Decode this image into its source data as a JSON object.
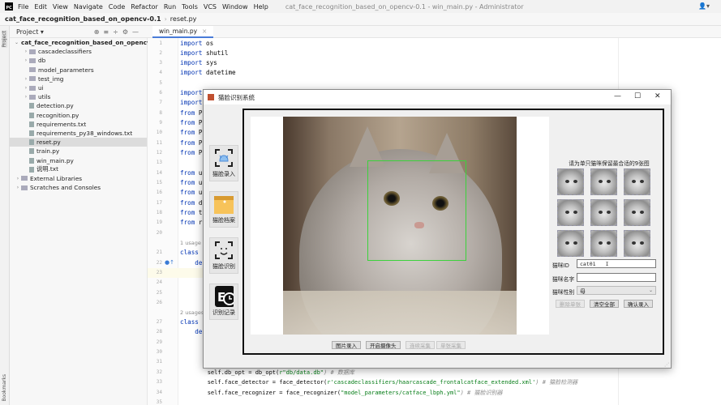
{
  "app": {
    "logo": "PC",
    "menu": [
      "File",
      "Edit",
      "View",
      "Navigate",
      "Code",
      "Refactor",
      "Run",
      "Tools",
      "VCS",
      "Window",
      "Help"
    ],
    "window_title": "cat_face_recognition_based_on_opencv-0.1 - win_main.py - Administrator"
  },
  "breadcrumb": {
    "project": "cat_face_recognition_based_on_opencv-0.1",
    "file": "reset.py"
  },
  "left_strip": {
    "top": "Project",
    "bottom": "Bookmarks"
  },
  "project_panel": {
    "title": "Project ▾",
    "tree": [
      {
        "label": "cat_face_recognition_based_on_opencv-0.1",
        "type": "folder",
        "depth": 0,
        "arrow": "⌄",
        "bold": true
      },
      {
        "label": "cascadeclassifiers",
        "type": "folder",
        "depth": 1,
        "arrow": "›"
      },
      {
        "label": "db",
        "type": "folder",
        "depth": 1,
        "arrow": "›"
      },
      {
        "label": "model_parameters",
        "type": "folder",
        "depth": 1,
        "arrow": ""
      },
      {
        "label": "test_img",
        "type": "folder",
        "depth": 1,
        "arrow": "›"
      },
      {
        "label": "ui",
        "type": "folder",
        "depth": 1,
        "arrow": "›"
      },
      {
        "label": "utils",
        "type": "folder",
        "depth": 1,
        "arrow": "›"
      },
      {
        "label": "detection.py",
        "type": "file",
        "depth": 1
      },
      {
        "label": "recognition.py",
        "type": "file",
        "depth": 1
      },
      {
        "label": "requirements.txt",
        "type": "file",
        "depth": 1
      },
      {
        "label": "requirements_py38_windows.txt",
        "type": "file",
        "depth": 1
      },
      {
        "label": "reset.py",
        "type": "file",
        "depth": 1,
        "selected": true
      },
      {
        "label": "train.py",
        "type": "file",
        "depth": 1
      },
      {
        "label": "win_main.py",
        "type": "file",
        "depth": 1
      },
      {
        "label": "说明.txt",
        "type": "file",
        "depth": 1
      },
      {
        "label": "External Libraries",
        "type": "folder",
        "depth": 0,
        "arrow": "›"
      },
      {
        "label": "Scratches and Consoles",
        "type": "folder",
        "depth": 0,
        "arrow": "›"
      }
    ]
  },
  "editor": {
    "tab": "win_main.py",
    "lines": [
      {
        "n": "1",
        "kw": "import",
        "rest": " os"
      },
      {
        "n": "2",
        "kw": "import",
        "rest": " shutil"
      },
      {
        "n": "3",
        "kw": "import",
        "rest": " sys"
      },
      {
        "n": "4",
        "kw": "import",
        "rest": " datetime"
      },
      {
        "n": "5"
      },
      {
        "n": "6",
        "kw": "import",
        "rest": ""
      },
      {
        "n": "7",
        "kw": "import",
        "rest": ""
      },
      {
        "n": "8",
        "kw": "from",
        "rest": " P"
      },
      {
        "n": "9",
        "kw": "from",
        "rest": " P"
      },
      {
        "n": "10",
        "kw": "from",
        "rest": " P"
      },
      {
        "n": "11",
        "kw": "from",
        "rest": " P"
      },
      {
        "n": "12",
        "kw": "from",
        "rest": " P"
      },
      {
        "n": "13"
      },
      {
        "n": "14",
        "kw": "from",
        "rest": " u"
      },
      {
        "n": "15",
        "kw": "from",
        "rest": " u"
      },
      {
        "n": "16",
        "kw": "from",
        "rest": " u"
      },
      {
        "n": "17",
        "kw": "from",
        "rest": " d"
      },
      {
        "n": "18",
        "kw": "from",
        "rest": " t"
      },
      {
        "n": "19",
        "kw": "from",
        "rest": " r"
      },
      {
        "n": "20"
      },
      {
        "n": "21",
        "kw": "class",
        "rest": " ",
        "usage": "1 usage"
      },
      {
        "n": "22",
        "kw": "    de",
        "rest": ""
      },
      {
        "n": "23"
      },
      {
        "n": "24"
      },
      {
        "n": "25"
      },
      {
        "n": "26"
      },
      {
        "n": "27",
        "kw": "class",
        "rest": " ",
        "usage": "2 usages"
      },
      {
        "n": "28",
        "kw": "    de",
        "rest": ""
      },
      {
        "n": "29"
      },
      {
        "n": "30"
      },
      {
        "n": "31"
      },
      {
        "n": "32",
        "code": "        self.db_opt = db_opt(",
        "str": "r\"db/data.db\"",
        "cmt": ") # 数据库"
      },
      {
        "n": "33",
        "code": "        self.face_detector = face_detector(",
        "str": "r'cascadeclassifiers/haarcascade_frontalcatface_extended.xml'",
        "cmt": ") # 猫脸检测器"
      },
      {
        "n": "34",
        "code": "        self.face_recognizer = face_recognizer(",
        "str": "\"model_parameters/catface_lbph.yml\"",
        "cmt": ") # 猫脸识别器"
      },
      {
        "n": "35"
      }
    ]
  },
  "dialog": {
    "title": "猫脸识别系统",
    "controls": {
      "minimize": "—",
      "maximize": "☐",
      "close": "✕"
    },
    "side_buttons": [
      {
        "label": "猫脸录入",
        "icon": "cat-scan-icon"
      },
      {
        "label": "猫脸档案",
        "icon": "archive-folder-icon"
      },
      {
        "label": "猫脸识别",
        "icon": "face-recognition-icon"
      },
      {
        "label": "识别记录",
        "icon": "history-record-icon"
      }
    ],
    "image_buttons": [
      {
        "label": "图片录入",
        "enabled": true
      },
      {
        "label": "开启摄像头",
        "enabled": true
      },
      {
        "label": "连续采集",
        "enabled": false
      },
      {
        "label": "单张采集",
        "enabled": false
      }
    ],
    "thumb_hint": "请为单只猫咪保留最合适的9张图",
    "thumb_count": 9,
    "form": {
      "id_label": "猫咪ID",
      "id_value": "cat01",
      "name_label": "猫咪名字",
      "name_value": "",
      "gender_label": "猫咪性别",
      "gender_value": "母"
    },
    "action_buttons": [
      {
        "label": "删除单张",
        "enabled": false
      },
      {
        "label": "清空全部",
        "enabled": true
      },
      {
        "label": "确认录入",
        "enabled": true
      }
    ],
    "colors": {
      "face_box": "#3cd23c",
      "accent": "#4a7cd8"
    }
  }
}
